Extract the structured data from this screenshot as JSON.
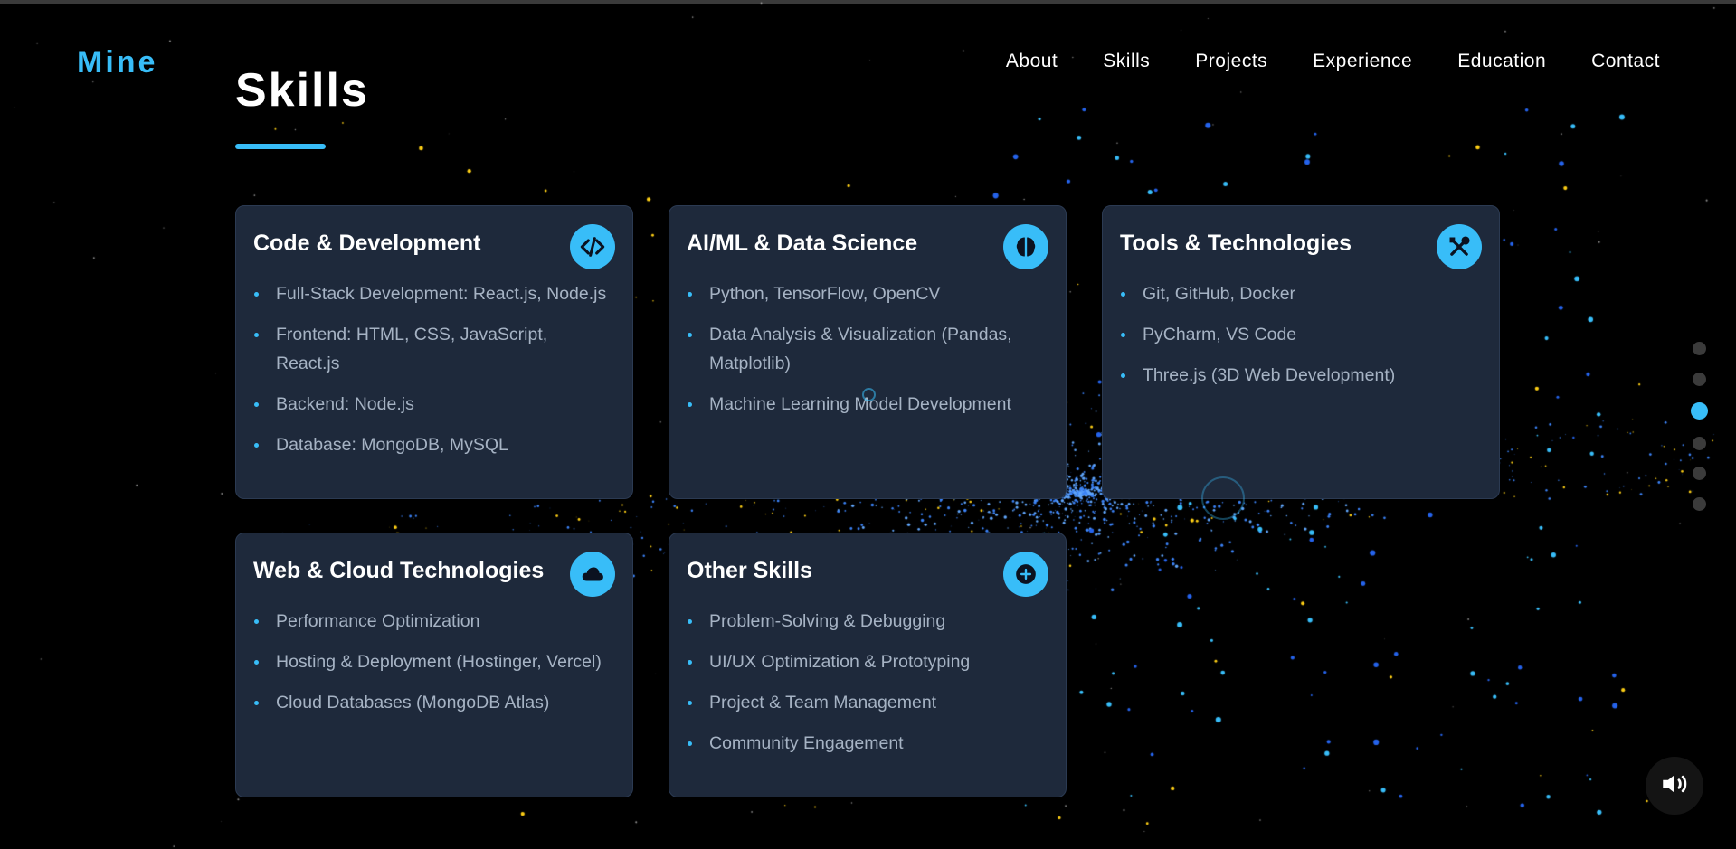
{
  "brand": {
    "logo": "Mine"
  },
  "nav": {
    "items": [
      "About",
      "Skills",
      "Projects",
      "Experience",
      "Education",
      "Contact"
    ]
  },
  "section": {
    "title": "Skills"
  },
  "cards": [
    {
      "title": "Code & Development",
      "icon": "code-icon",
      "items": [
        "Full-Stack Development: React.js, Node.js",
        "Frontend: HTML, CSS, JavaScript, React.js",
        "Backend: Node.js",
        "Database: MongoDB, MySQL"
      ]
    },
    {
      "title": "AI/ML & Data Science",
      "icon": "brain-icon",
      "items": [
        "Python, TensorFlow, OpenCV",
        "Data Analysis & Visualization (Pandas, Matplotlib)",
        "Machine Learning Model Development"
      ]
    },
    {
      "title": "Tools & Technologies",
      "icon": "tools-icon",
      "items": [
        "Git, GitHub, Docker",
        "PyCharm, VS Code",
        "Three.js (3D Web Development)"
      ]
    },
    {
      "title": "Web & Cloud Technologies",
      "icon": "cloud-icon",
      "items": [
        "Performance Optimization",
        "Hosting & Deployment (Hostinger, Vercel)",
        "Cloud Databases (MongoDB Atlas)"
      ]
    },
    {
      "title": "Other Skills",
      "icon": "plus-circle-icon",
      "items": [
        "Problem-Solving & Debugging",
        "UI/UX Optimization & Prototyping",
        "Project & Team Management",
        "Community Engagement"
      ]
    }
  ],
  "section_nav": {
    "count": 6,
    "active_index": 2
  },
  "sound_toggle": {
    "icon": "volume-icon"
  },
  "colors": {
    "accent": "#38bdf8",
    "card_bg": "#1e293b",
    "text_muted": "#a6b3c4",
    "background": "#000000"
  }
}
